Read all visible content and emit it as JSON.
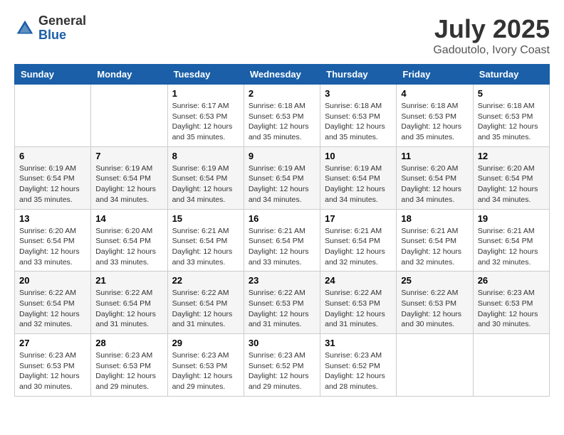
{
  "logo": {
    "general": "General",
    "blue": "Blue"
  },
  "title": "July 2025",
  "location": "Gadoutolo, Ivory Coast",
  "weekdays": [
    "Sunday",
    "Monday",
    "Tuesday",
    "Wednesday",
    "Thursday",
    "Friday",
    "Saturday"
  ],
  "weeks": [
    [
      {
        "day": "",
        "info": ""
      },
      {
        "day": "",
        "info": ""
      },
      {
        "day": "1",
        "info": "Sunrise: 6:17 AM\nSunset: 6:53 PM\nDaylight: 12 hours and 35 minutes."
      },
      {
        "day": "2",
        "info": "Sunrise: 6:18 AM\nSunset: 6:53 PM\nDaylight: 12 hours and 35 minutes."
      },
      {
        "day": "3",
        "info": "Sunrise: 6:18 AM\nSunset: 6:53 PM\nDaylight: 12 hours and 35 minutes."
      },
      {
        "day": "4",
        "info": "Sunrise: 6:18 AM\nSunset: 6:53 PM\nDaylight: 12 hours and 35 minutes."
      },
      {
        "day": "5",
        "info": "Sunrise: 6:18 AM\nSunset: 6:53 PM\nDaylight: 12 hours and 35 minutes."
      }
    ],
    [
      {
        "day": "6",
        "info": "Sunrise: 6:19 AM\nSunset: 6:54 PM\nDaylight: 12 hours and 35 minutes."
      },
      {
        "day": "7",
        "info": "Sunrise: 6:19 AM\nSunset: 6:54 PM\nDaylight: 12 hours and 34 minutes."
      },
      {
        "day": "8",
        "info": "Sunrise: 6:19 AM\nSunset: 6:54 PM\nDaylight: 12 hours and 34 minutes."
      },
      {
        "day": "9",
        "info": "Sunrise: 6:19 AM\nSunset: 6:54 PM\nDaylight: 12 hours and 34 minutes."
      },
      {
        "day": "10",
        "info": "Sunrise: 6:19 AM\nSunset: 6:54 PM\nDaylight: 12 hours and 34 minutes."
      },
      {
        "day": "11",
        "info": "Sunrise: 6:20 AM\nSunset: 6:54 PM\nDaylight: 12 hours and 34 minutes."
      },
      {
        "day": "12",
        "info": "Sunrise: 6:20 AM\nSunset: 6:54 PM\nDaylight: 12 hours and 34 minutes."
      }
    ],
    [
      {
        "day": "13",
        "info": "Sunrise: 6:20 AM\nSunset: 6:54 PM\nDaylight: 12 hours and 33 minutes."
      },
      {
        "day": "14",
        "info": "Sunrise: 6:20 AM\nSunset: 6:54 PM\nDaylight: 12 hours and 33 minutes."
      },
      {
        "day": "15",
        "info": "Sunrise: 6:21 AM\nSunset: 6:54 PM\nDaylight: 12 hours and 33 minutes."
      },
      {
        "day": "16",
        "info": "Sunrise: 6:21 AM\nSunset: 6:54 PM\nDaylight: 12 hours and 33 minutes."
      },
      {
        "day": "17",
        "info": "Sunrise: 6:21 AM\nSunset: 6:54 PM\nDaylight: 12 hours and 32 minutes."
      },
      {
        "day": "18",
        "info": "Sunrise: 6:21 AM\nSunset: 6:54 PM\nDaylight: 12 hours and 32 minutes."
      },
      {
        "day": "19",
        "info": "Sunrise: 6:21 AM\nSunset: 6:54 PM\nDaylight: 12 hours and 32 minutes."
      }
    ],
    [
      {
        "day": "20",
        "info": "Sunrise: 6:22 AM\nSunset: 6:54 PM\nDaylight: 12 hours and 32 minutes."
      },
      {
        "day": "21",
        "info": "Sunrise: 6:22 AM\nSunset: 6:54 PM\nDaylight: 12 hours and 31 minutes."
      },
      {
        "day": "22",
        "info": "Sunrise: 6:22 AM\nSunset: 6:54 PM\nDaylight: 12 hours and 31 minutes."
      },
      {
        "day": "23",
        "info": "Sunrise: 6:22 AM\nSunset: 6:53 PM\nDaylight: 12 hours and 31 minutes."
      },
      {
        "day": "24",
        "info": "Sunrise: 6:22 AM\nSunset: 6:53 PM\nDaylight: 12 hours and 31 minutes."
      },
      {
        "day": "25",
        "info": "Sunrise: 6:22 AM\nSunset: 6:53 PM\nDaylight: 12 hours and 30 minutes."
      },
      {
        "day": "26",
        "info": "Sunrise: 6:23 AM\nSunset: 6:53 PM\nDaylight: 12 hours and 30 minutes."
      }
    ],
    [
      {
        "day": "27",
        "info": "Sunrise: 6:23 AM\nSunset: 6:53 PM\nDaylight: 12 hours and 30 minutes."
      },
      {
        "day": "28",
        "info": "Sunrise: 6:23 AM\nSunset: 6:53 PM\nDaylight: 12 hours and 29 minutes."
      },
      {
        "day": "29",
        "info": "Sunrise: 6:23 AM\nSunset: 6:53 PM\nDaylight: 12 hours and 29 minutes."
      },
      {
        "day": "30",
        "info": "Sunrise: 6:23 AM\nSunset: 6:52 PM\nDaylight: 12 hours and 29 minutes."
      },
      {
        "day": "31",
        "info": "Sunrise: 6:23 AM\nSunset: 6:52 PM\nDaylight: 12 hours and 28 minutes."
      },
      {
        "day": "",
        "info": ""
      },
      {
        "day": "",
        "info": ""
      }
    ]
  ]
}
